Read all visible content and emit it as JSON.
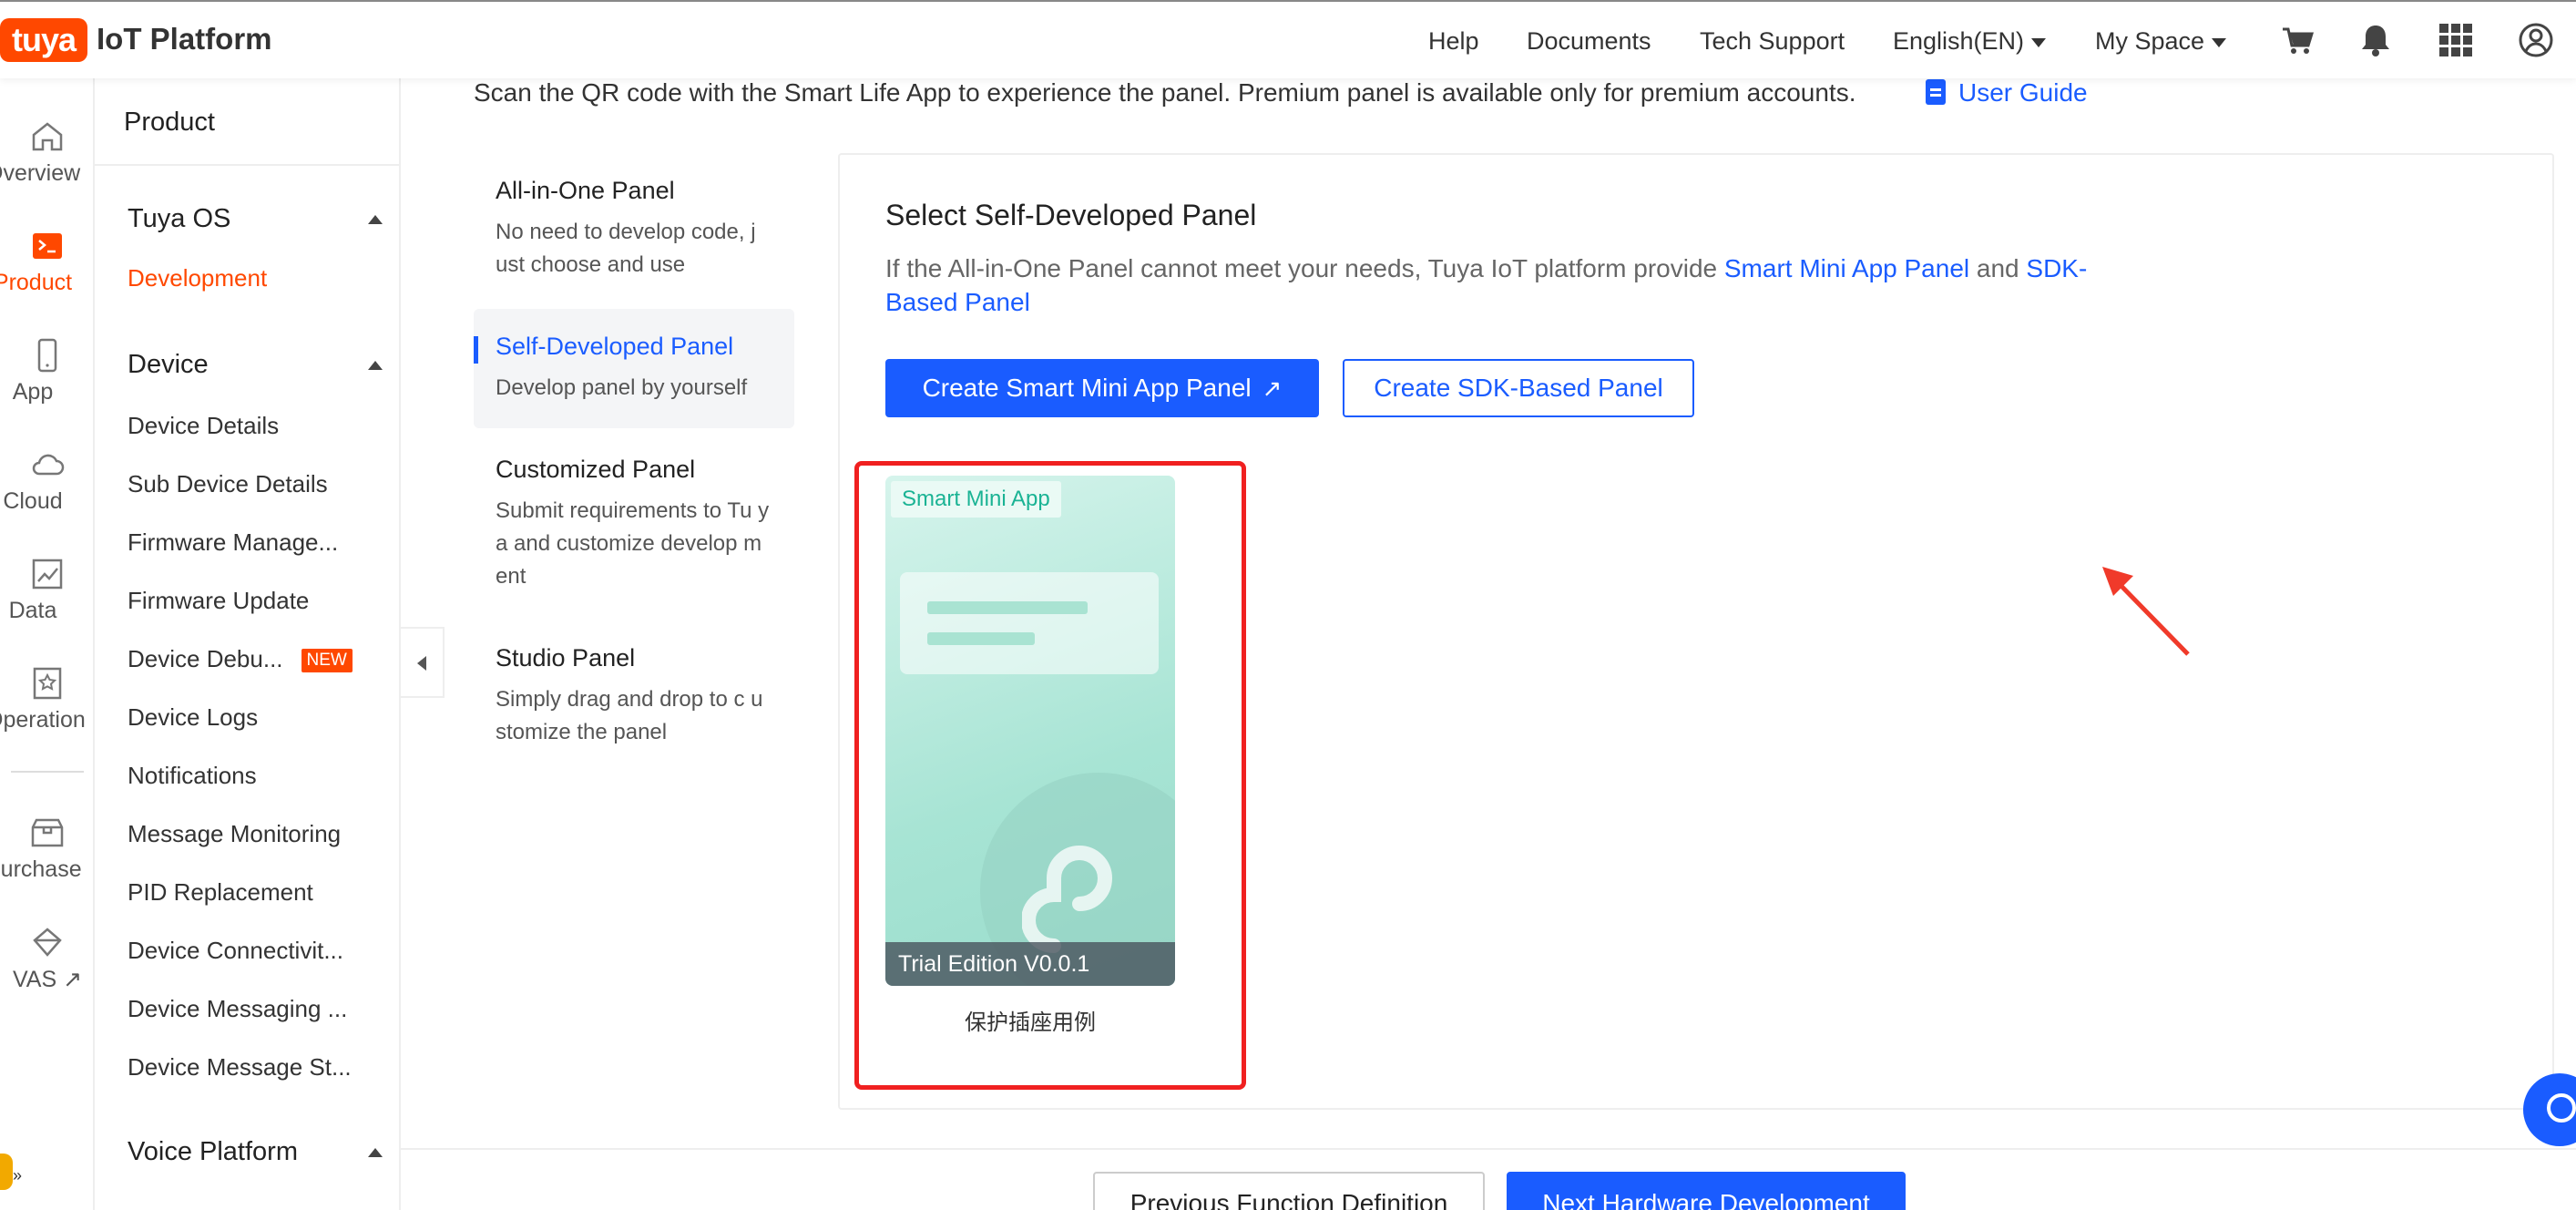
{
  "brand": {
    "logo_text": "tuya",
    "platform": "IoT Platform",
    "color": "#ff4800"
  },
  "topnav": {
    "help": "Help",
    "documents": "Documents",
    "tech_support": "Tech Support",
    "language": "English(EN)",
    "my_space": "My Space"
  },
  "rail": [
    {
      "label": "Overview",
      "icon": "home-icon"
    },
    {
      "label": "Product",
      "icon": "terminal-icon",
      "active": true
    },
    {
      "label": "App",
      "icon": "phone-icon"
    },
    {
      "label": "Cloud",
      "icon": "cloud-icon"
    },
    {
      "label": "Data",
      "icon": "chart-icon"
    },
    {
      "label": "Operation",
      "icon": "star-badge-icon"
    },
    {
      "label": "Purchase",
      "icon": "box-icon"
    },
    {
      "label": "VAS",
      "icon": "diamond-icon"
    }
  ],
  "sidebar": {
    "title": "Product",
    "sections": [
      {
        "label": "Tuya OS",
        "items": [
          "Development"
        ]
      },
      {
        "label": "Device",
        "items": [
          "Device Details",
          "Sub Device Details",
          "Firmware Manage...",
          "Firmware Update",
          "Device Debu...",
          "Device Logs",
          "Notifications",
          "Message Monitoring",
          "PID Replacement",
          "Device Connectivit...",
          "Device Messaging ...",
          "Device Message St..."
        ]
      },
      {
        "label": "Voice Platform",
        "items": []
      }
    ],
    "new_badge": "NEW"
  },
  "notice": "Scan the QR code with the Smart Life App to experience the panel. Premium panel is available only for premium accounts.",
  "user_guide": "User Guide",
  "panel_types": [
    {
      "title": "All-in-One Panel",
      "desc": "No need to develop code, j ust choose and use"
    },
    {
      "title": "Self-Developed Panel",
      "desc": "Develop panel by yourself",
      "active": true
    },
    {
      "title": "Customized Panel",
      "desc": "Submit requirements to Tu ya and customize develop ment"
    },
    {
      "title": "Studio Panel",
      "desc": "Simply drag and drop to c ustomize the panel"
    }
  ],
  "self_dev": {
    "title": "Select Self-Developed Panel",
    "desc_prefix": "If the All-in-One Panel cannot meet your needs, Tuya IoT platform provide ",
    "link1": "Smart Mini App Panel",
    "and": " and ",
    "link2": "SDK-Based Panel",
    "btn_create_mini": "Create Smart Mini App Panel",
    "btn_create_sdk": "Create SDK-Based Panel"
  },
  "preview": {
    "tag": "Smart Mini App",
    "edition": "Trial Edition V0.0.1",
    "name": "保护插座用例"
  },
  "footer": {
    "prev": "Previous Function Definition",
    "next": "Next Hardware Development"
  }
}
